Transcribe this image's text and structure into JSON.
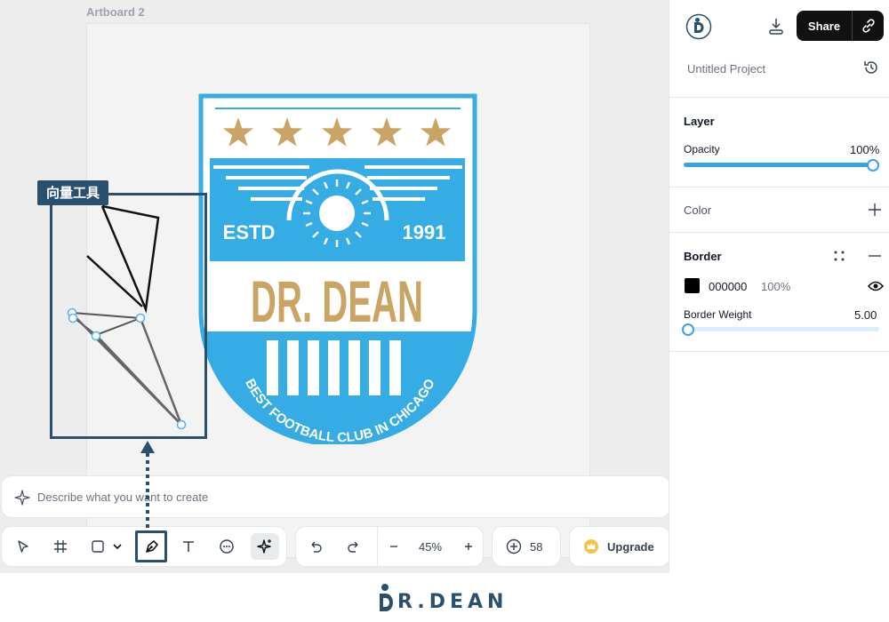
{
  "canvas": {
    "artboard_label": "Artboard 2",
    "callout_label": "向量工具"
  },
  "badge": {
    "estd_label": "ESTD",
    "year": "1991",
    "title": "DR. DEAN",
    "arc_text": "BEST FOOTBALL CLUB IN CHICAGO",
    "colors": {
      "primary": "#35ace3",
      "gold": "#c9a465"
    }
  },
  "prompt": {
    "placeholder": "Describe what you want to create"
  },
  "toolbar": {
    "tools": [
      "pointer-icon",
      "frame-icon",
      "rectangle-icon",
      "chevron-down-icon",
      "pen-icon",
      "text-icon",
      "comment-icon",
      "ai-sparkle-icon"
    ],
    "zoom": "45%",
    "credits": "58",
    "upgrade_label": "Upgrade"
  },
  "panel": {
    "project_name": "Untitled Project",
    "share_label": "Share",
    "layer": {
      "title": "Layer",
      "opacity_label": "Opacity",
      "opacity_value": "100%",
      "opacity_fraction": 1.0
    },
    "color": {
      "title": "Color"
    },
    "border": {
      "title": "Border",
      "hex": "000000",
      "opacity": "100%",
      "weight_label": "Border Weight",
      "weight_value": "5.00",
      "weight_fraction": 0.0
    },
    "accent": "#3aa3e8"
  },
  "footer": {
    "logo_text": "R.DEAN"
  }
}
